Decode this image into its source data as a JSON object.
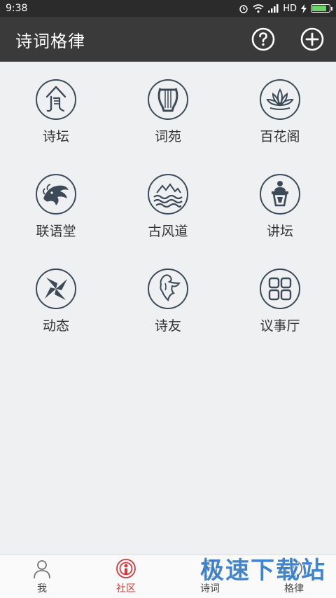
{
  "status_bar": {
    "time": "9:38",
    "network": "HD"
  },
  "app_bar": {
    "title": "诗词格律",
    "help_icon": "question-circle-icon",
    "add_icon": "plus-circle-icon"
  },
  "grid": {
    "items": [
      {
        "label": "诗坛",
        "icon": "pavilion-icon"
      },
      {
        "label": "词苑",
        "icon": "lyre-icon"
      },
      {
        "label": "百花阁",
        "icon": "lotus-icon"
      },
      {
        "label": "联语堂",
        "icon": "dragon-icon"
      },
      {
        "label": "古风道",
        "icon": "mountain-wave-icon"
      },
      {
        "label": "讲坛",
        "icon": "podium-icon"
      },
      {
        "label": "动态",
        "icon": "pinwheel-icon"
      },
      {
        "label": "诗友",
        "icon": "figure-icon"
      },
      {
        "label": "议事厅",
        "icon": "four-squares-icon"
      }
    ]
  },
  "bottom_nav": {
    "items": [
      {
        "label": "我",
        "icon": "person-icon"
      },
      {
        "label": "社区",
        "icon": "community-icon"
      },
      {
        "label": "诗词",
        "icon": "poetry-icon"
      },
      {
        "label": "格律",
        "icon": "rhythm-icon"
      }
    ],
    "active_index": 1
  },
  "watermark": "极速下载站",
  "colors": {
    "app_bar": "#3a3a3a",
    "status_bar": "#2b2b2b",
    "background": "#eef0f2",
    "icon_stroke": "#3d4a57",
    "active_nav": "#d23b3b",
    "watermark": "#2b78c8"
  }
}
